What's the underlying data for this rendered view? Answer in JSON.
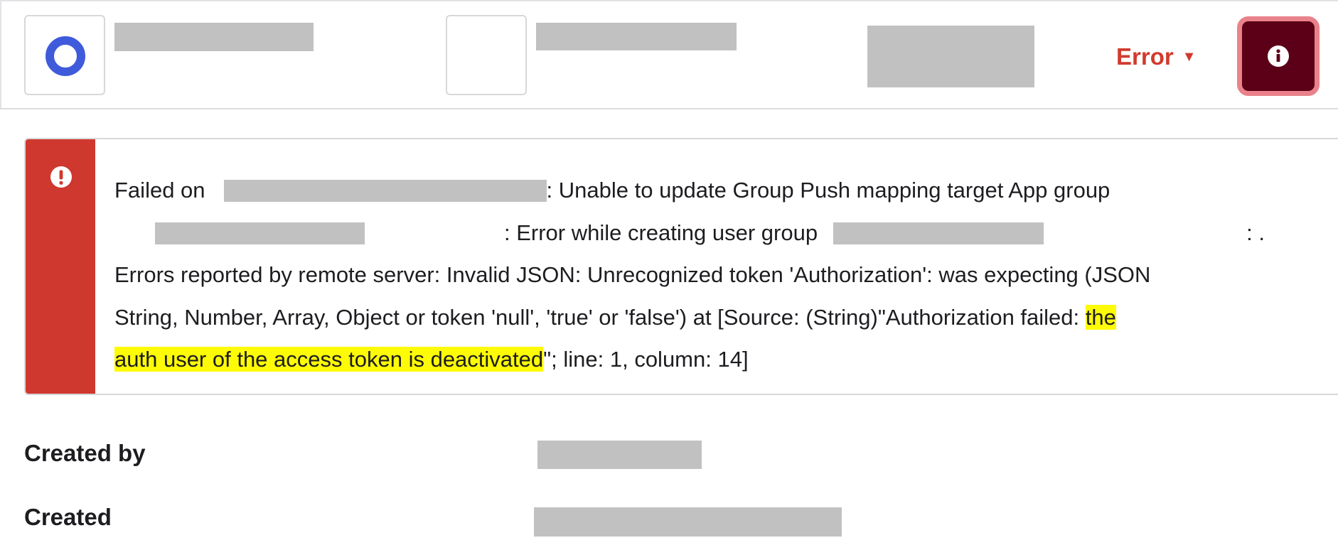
{
  "header": {
    "status_label": "Error",
    "status_caret": "▼",
    "info_icon": "info-icon"
  },
  "error": {
    "icon": "alert-icon",
    "line1": {
      "prefix": "Failed on",
      "suffix": ": Unable to update Group Push mapping target App group"
    },
    "line2": {
      "middle": ": Error while creating user group",
      "suffix": ": ."
    },
    "line3": "Errors reported by remote server: Invalid JSON: Unrecognized token 'Authorization': was expecting (JSON",
    "line4": {
      "text": "String, Number, Array, Object or token 'null', 'true' or 'false') at [Source: (String)\"Authorization failed: ",
      "highlight": "the"
    },
    "line5": {
      "highlight": "auth user of the access token is deactivated",
      "suffix": "\"; line: 1, column: 14]"
    }
  },
  "meta": {
    "created_by_label": "Created by",
    "created_label": "Created"
  },
  "colors": {
    "error_red": "#cf382e",
    "ring_blue": "#3f5bdb",
    "info_button_bg": "#5b0016",
    "info_button_border": "#e9828a",
    "highlight": "#fefb06"
  }
}
